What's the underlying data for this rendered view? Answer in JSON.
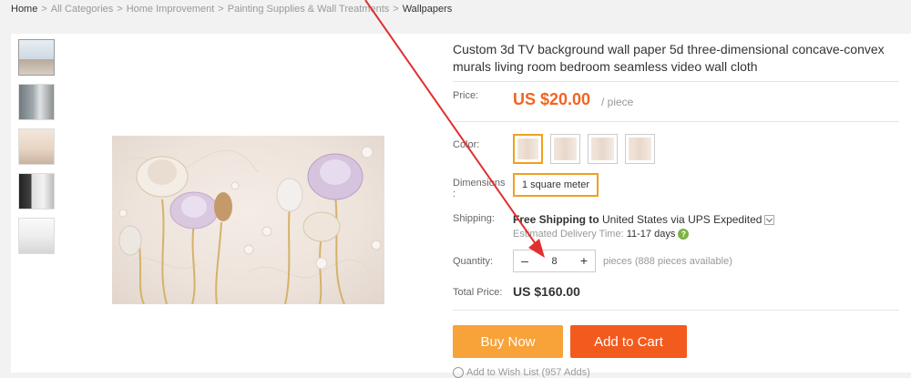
{
  "breadcrumb": {
    "items": [
      "Home",
      "All Categories",
      "Home Improvement",
      "Painting Supplies & Wall Treatments"
    ],
    "current": "Wallpapers",
    "separator": ">"
  },
  "product": {
    "title": "Custom 3d TV background wall paper 5d three-dimensional concave-convex murals living room bedroom seamless video wall cloth",
    "price_label": "Price:",
    "price": "US $20.00",
    "price_unit": "/ piece",
    "color_label": "Color:",
    "dimensions_label": "Dimensions\n:",
    "dimension_value": "1 square meter",
    "shipping_label": "Shipping:",
    "shipping_free": "Free Shipping to",
    "shipping_destination": "United States via UPS Expedited",
    "delivery_label": "Estimated Delivery Time:",
    "delivery_days": "11-17 days",
    "help_glyph": "?",
    "quantity_label": "Quantity:",
    "quantity_value": "8",
    "quantity_minus": "–",
    "quantity_plus": "+",
    "quantity_available": "pieces (888 pieces available)",
    "total_label": "Total Price:",
    "total_value": "US $160.00",
    "buy_now": "Buy Now",
    "add_to_cart": "Add to Cart",
    "wishlist": "Add to Wish List (957 Adds)"
  },
  "colors": {
    "accent_orange": "#f26522",
    "selected_border": "#f0a020",
    "buy_now_bg": "#f8a23a",
    "add_to_cart_bg": "#f25a1e",
    "annotation_arrow": "#e03030"
  },
  "icons": {
    "shipping_dropdown": "chevron-down-icon",
    "help": "question-circle-icon",
    "wishlist": "heart-icon"
  }
}
